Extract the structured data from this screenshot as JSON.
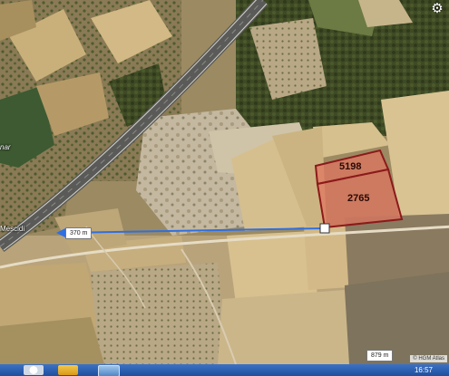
{
  "map": {
    "place_label": "Mescidi",
    "partial_label": "nar",
    "parcels": [
      {
        "number": "5198"
      },
      {
        "number": "2765"
      }
    ],
    "measurement": {
      "distance_label": "370 m",
      "line_color": "#2f6fe0"
    },
    "scale_label": "879 m",
    "attribution": "© HGM Atlas",
    "parcel_fill": "#e07560",
    "parcel_outline": "#8b1a1a",
    "settings_icon": "gear-icon"
  },
  "taskbar": {
    "clock": "16:57",
    "apps": [
      "start-button-icon",
      "folder-icon",
      "window-icon"
    ]
  }
}
